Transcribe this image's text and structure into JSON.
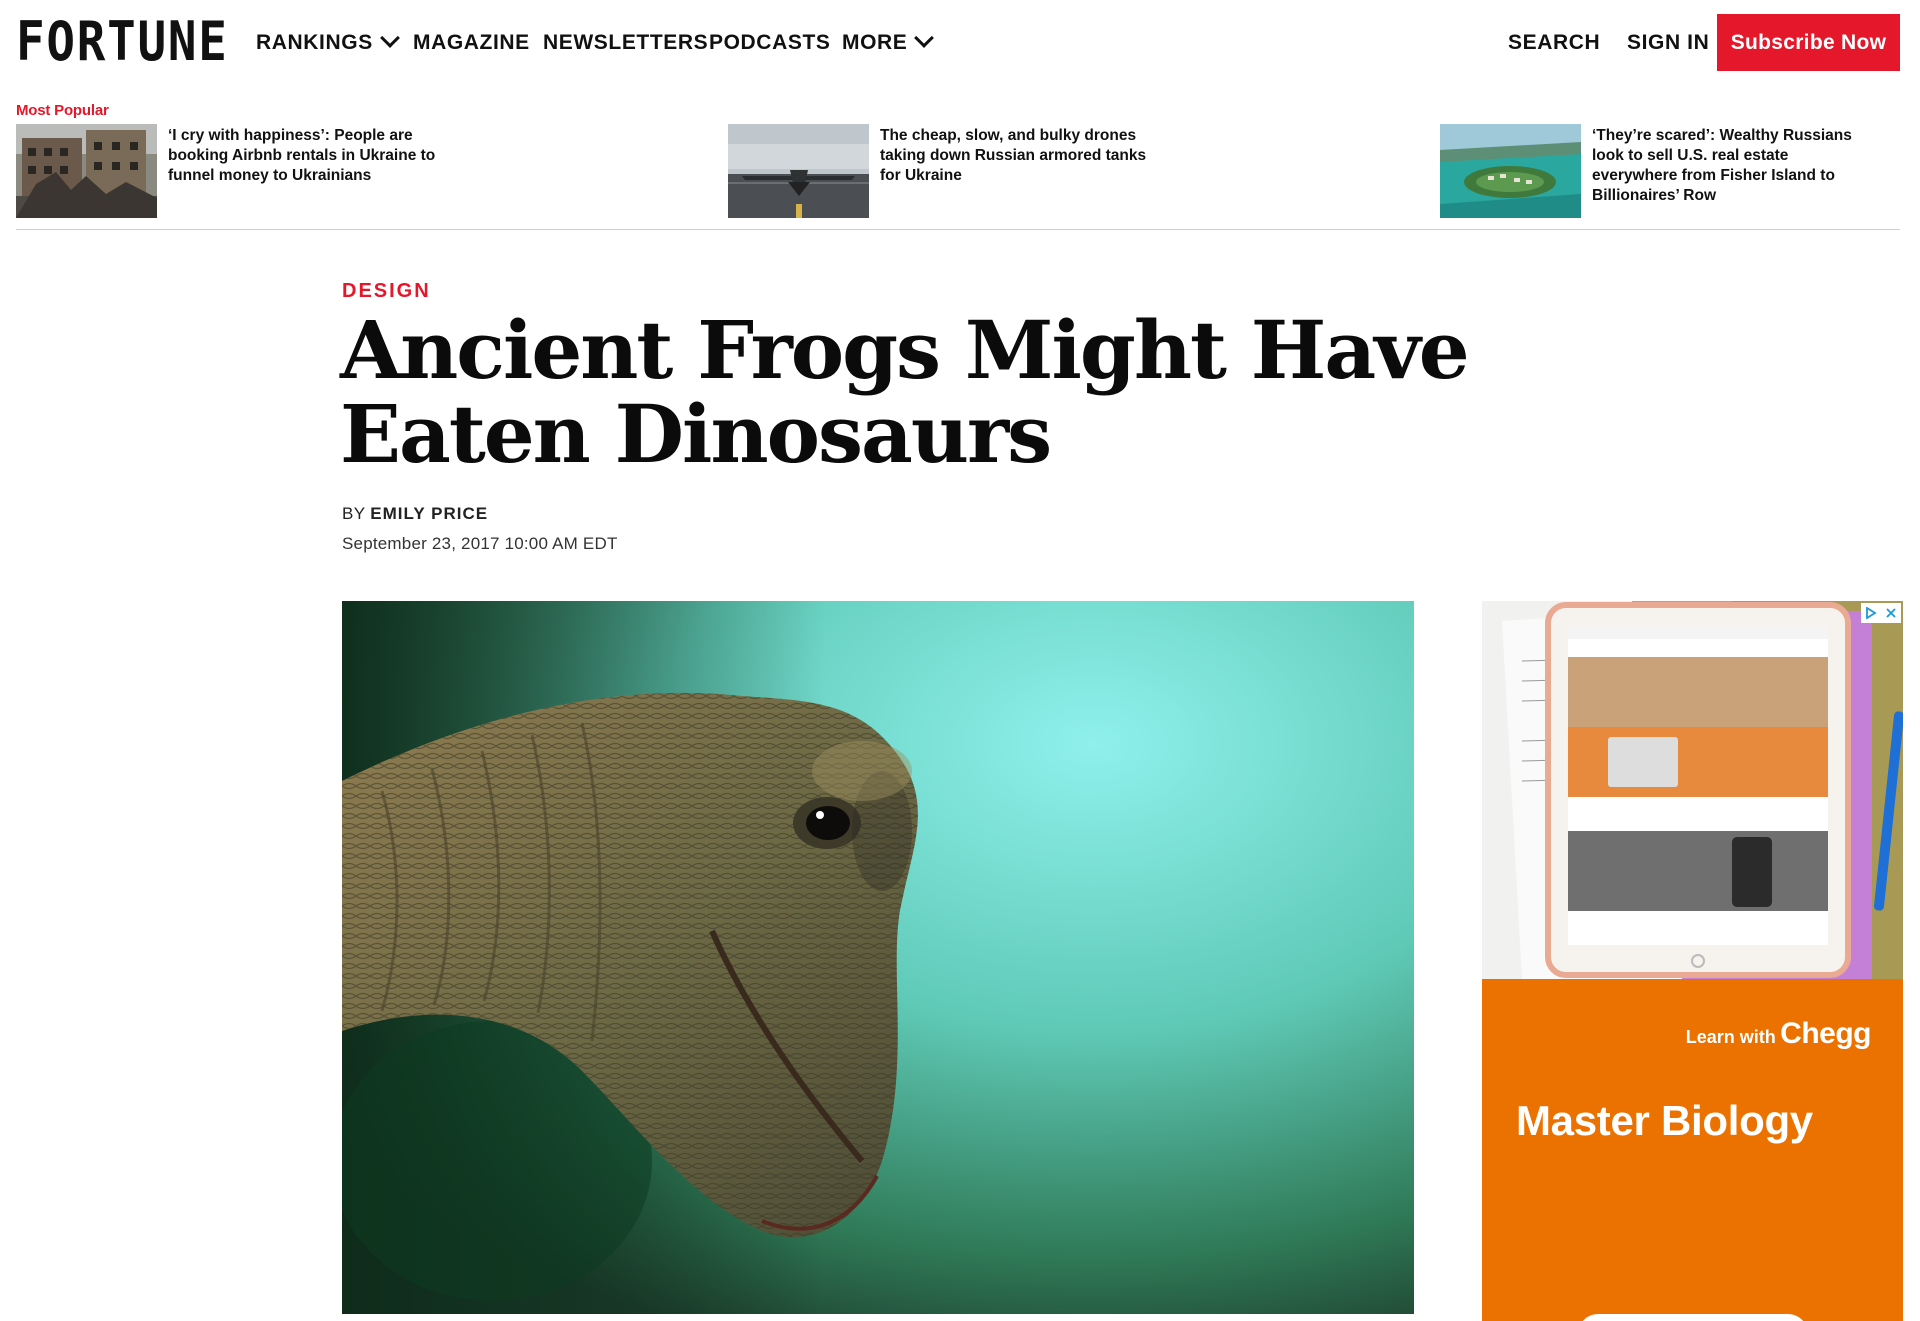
{
  "brand": {
    "logo": "FORTUNE"
  },
  "nav": {
    "items": [
      {
        "label": "RANKINGS",
        "dropdown": true
      },
      {
        "label": "MAGAZINE"
      },
      {
        "label": "NEWSLETTERS"
      },
      {
        "label": "PODCASTS"
      },
      {
        "label": "MORE",
        "dropdown": true
      }
    ],
    "search": "SEARCH",
    "sign_in": "SIGN IN",
    "subscribe": "Subscribe Now"
  },
  "most_popular": {
    "label": "Most Popular",
    "items": [
      {
        "title": "‘I cry with happiness’: People are booking Airbnb rentals in Ukraine to funnel money to Ukrainians"
      },
      {
        "title": "The cheap, slow, and bulky drones taking down Russian armored tanks for Ukraine"
      },
      {
        "title": "‘They’re scared’: Wealthy Russians look to sell U.S. real estate everywhere from Fisher Island to Billionaires’ Row"
      }
    ]
  },
  "article": {
    "category": "DESIGN",
    "headline": "Ancient Frogs Might Have Eaten Dinosaurs",
    "by": "BY",
    "author": "EMILY PRICE",
    "date": "September 23, 2017 10:00 AM EDT"
  },
  "ad": {
    "learn_with": "Learn with",
    "brand": "Chegg",
    "headline": "Master Biology"
  },
  "colors": {
    "accent": "#e4182a",
    "ad_orange": "#eb7100"
  }
}
